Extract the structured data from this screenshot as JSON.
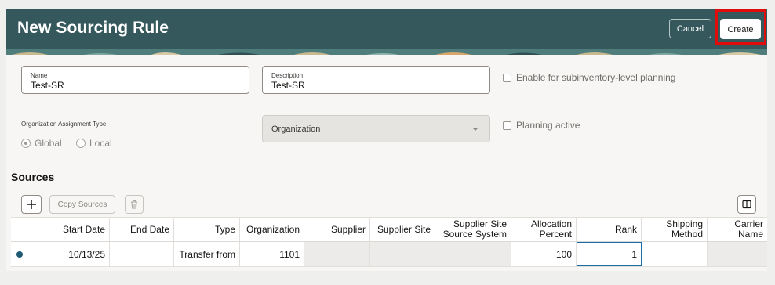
{
  "header": {
    "title": "New Sourcing Rule",
    "cancel_label": "Cancel",
    "create_label": "Create"
  },
  "form": {
    "name_label": "Name",
    "name_value": "Test-SR",
    "description_label": "Description",
    "description_value": "Test-SR",
    "subinventory_checkbox_label": "Enable for subinventory-level planning",
    "org_assignment_label": "Organization Assignment Type",
    "radio_global": "Global",
    "radio_local": "Local",
    "selected_assignment": "Global",
    "organization_placeholder": "Organization",
    "planning_active_label": "Planning active"
  },
  "sources": {
    "title": "Sources",
    "copy_sources_label": "Copy Sources",
    "columns": [
      "Start Date",
      "End Date",
      "Type",
      "Organization",
      "Supplier",
      "Supplier Site",
      "Supplier Site Source System",
      "Allocation Percent",
      "Rank",
      "Shipping Method",
      "Carrier Name"
    ],
    "rows": [
      {
        "start_date": "10/13/25",
        "end_date": "",
        "type": "Transfer from",
        "organization": "1101",
        "supplier": "",
        "supplier_site": "",
        "supplier_site_source_system": "",
        "allocation_percent": "100",
        "rank": "1",
        "shipping_method": "",
        "carrier_name": ""
      }
    ]
  },
  "colors": {
    "header_bg": "#35585c",
    "highlight": "#e00b0b",
    "row_indicator": "#1e5a72"
  },
  "icons": [
    "plus-icon",
    "trash-icon",
    "columns-icon",
    "chevron-down-icon"
  ]
}
